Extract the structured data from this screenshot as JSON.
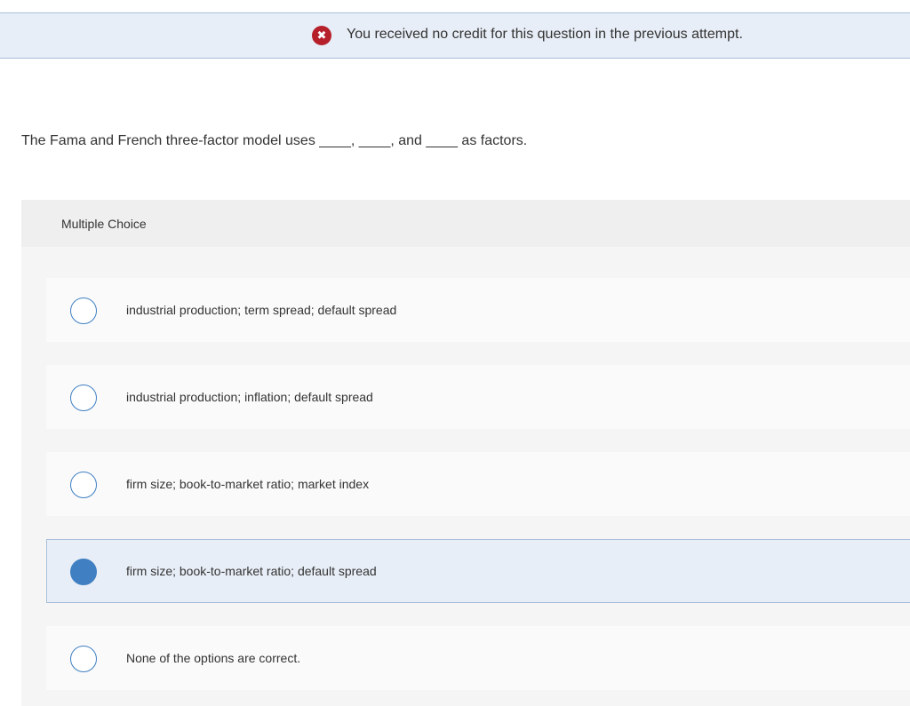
{
  "feedback": {
    "icon": "x-circle-icon",
    "icon_glyph": "✖",
    "message": "You received no credit for this question in the previous attempt.",
    "color": "#b5202b"
  },
  "question": {
    "text": "The Fama and French three-factor model uses ____, ____, and ____ as factors."
  },
  "multiple_choice": {
    "header": "Multiple Choice",
    "selected_index": 3,
    "options": [
      {
        "label": "industrial production; term spread; default spread",
        "selected": false
      },
      {
        "label": "industrial production; inflation; default spread",
        "selected": false
      },
      {
        "label": "firm size; book-to-market ratio; market index",
        "selected": false
      },
      {
        "label": "firm size; book-to-market ratio; default spread",
        "selected": true
      },
      {
        "label": "None of the options are correct.",
        "selected": false
      }
    ]
  },
  "colors": {
    "accent": "#3f7fc2",
    "banner_bg": "#e8eef7",
    "banner_border": "#a9bed9"
  }
}
